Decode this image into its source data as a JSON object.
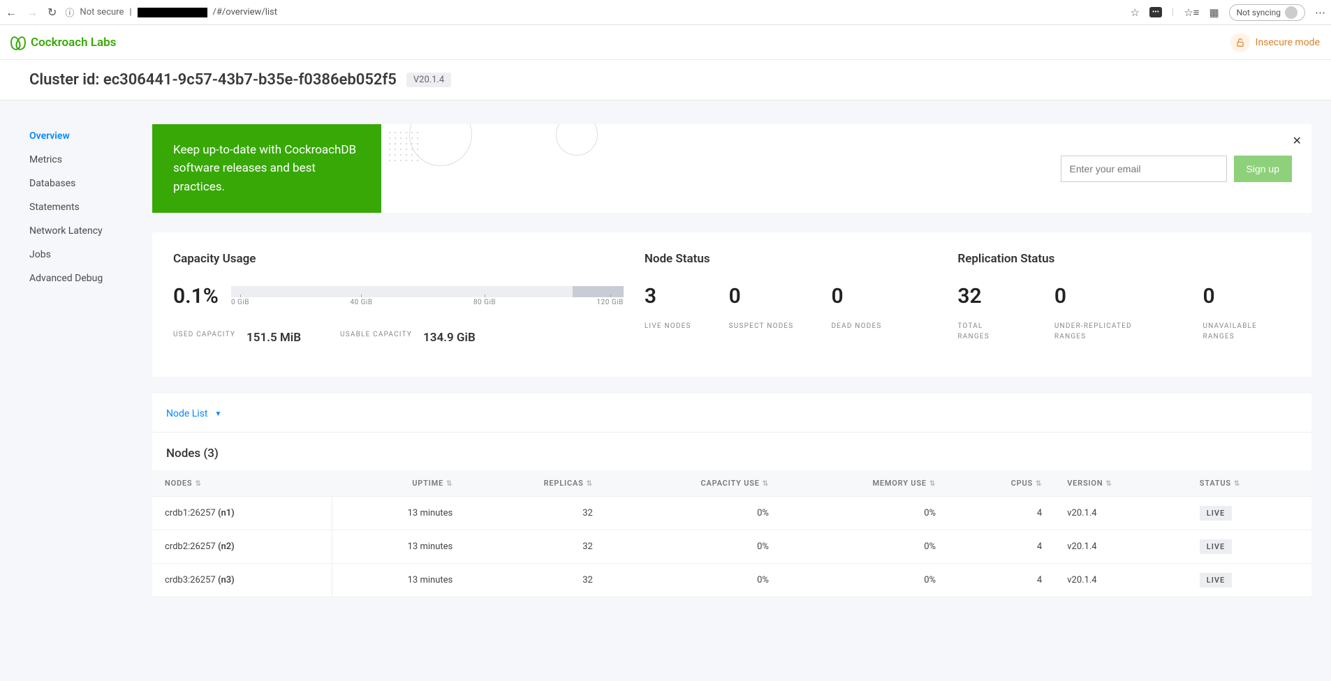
{
  "browser": {
    "not_secure_label": "Not secure",
    "url_suffix": "/#/overview/list",
    "not_syncing": "Not syncing"
  },
  "header": {
    "brand": "Cockroach Labs",
    "insecure_label": "Insecure mode"
  },
  "cluster": {
    "title": "Cluster id: ec306441-9c57-43b7-b35e-f0386eb052f5",
    "version": "V20.1.4"
  },
  "sidebar": {
    "items": [
      {
        "label": "Overview",
        "active": true
      },
      {
        "label": "Metrics"
      },
      {
        "label": "Databases"
      },
      {
        "label": "Statements"
      },
      {
        "label": "Network Latency"
      },
      {
        "label": "Jobs"
      },
      {
        "label": "Advanced Debug"
      }
    ]
  },
  "banner": {
    "text": "Keep up-to-date with CockroachDB software releases and best practices.",
    "email_placeholder": "Enter your email",
    "signup_label": "Sign up"
  },
  "summary": {
    "capacity": {
      "title": "Capacity Usage",
      "percent": "0.1%",
      "ticks": [
        "0 GiB",
        "40 GiB",
        "80 GiB",
        "120 GiB"
      ],
      "used_label": "USED CAPACITY",
      "used_value": "151.5 MiB",
      "usable_label": "USABLE CAPACITY",
      "usable_value": "134.9 GiB"
    },
    "nodes": {
      "title": "Node Status",
      "live": "3",
      "suspect": "0",
      "dead": "0",
      "live_label": "LIVE NODES",
      "suspect_label": "SUSPECT NODES",
      "dead_label": "DEAD NODES"
    },
    "replication": {
      "title": "Replication Status",
      "total": "32",
      "under": "0",
      "unavail": "0",
      "total_label": "TOTAL RANGES",
      "under_label": "UNDER-REPLICATED RANGES",
      "unavail_label": "UNAVAILABLE RANGES"
    }
  },
  "nodes_panel": {
    "tab_label": "Node List",
    "heading": "Nodes (3)",
    "columns": [
      "NODES",
      "UPTIME",
      "REPLICAS",
      "CAPACITY USE",
      "MEMORY USE",
      "CPUS",
      "VERSION",
      "STATUS"
    ],
    "rows": [
      {
        "host": "crdb1:26257",
        "nid": "(n1)",
        "uptime": "13 minutes",
        "replicas": "32",
        "capacity": "0%",
        "memory": "0%",
        "cpus": "4",
        "version": "v20.1.4",
        "status": "LIVE"
      },
      {
        "host": "crdb2:26257",
        "nid": "(n2)",
        "uptime": "13 minutes",
        "replicas": "32",
        "capacity": "0%",
        "memory": "0%",
        "cpus": "4",
        "version": "v20.1.4",
        "status": "LIVE"
      },
      {
        "host": "crdb3:26257",
        "nid": "(n3)",
        "uptime": "13 minutes",
        "replicas": "32",
        "capacity": "0%",
        "memory": "0%",
        "cpus": "4",
        "version": "v20.1.4",
        "status": "LIVE"
      }
    ]
  }
}
